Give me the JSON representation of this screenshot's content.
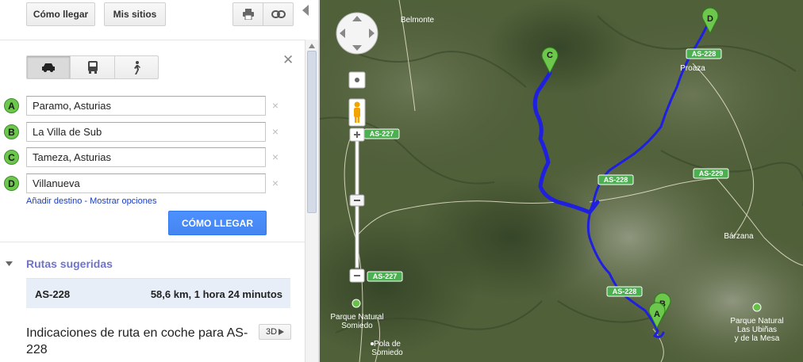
{
  "topbar": {
    "directions_label": "Cómo llegar",
    "my_places_label": "Mis sitios"
  },
  "waypoints": [
    {
      "letter": "A",
      "value": "Paramo, Asturias"
    },
    {
      "letter": "B",
      "value": "La Villa de Sub"
    },
    {
      "letter": "C",
      "value": "Tameza, Asturias"
    },
    {
      "letter": "D",
      "value": "Villanueva"
    }
  ],
  "links": {
    "add_destination": "Añadir destino",
    "separator": " - ",
    "show_options": "Mostrar opciones"
  },
  "submit_label": "CÓMO LLEGAR",
  "routes": {
    "header": "Rutas sugeridas",
    "items": [
      {
        "name": "AS-228",
        "summary": "58,6 km, 1 hora 24 minutos"
      }
    ]
  },
  "driving": {
    "title": "Indicaciones de ruta en coche para AS-228",
    "button_3d": "3D"
  },
  "map": {
    "place_labels": {
      "belmonte": "Belmonte",
      "proaza": "Proaza",
      "barzana": "Bárzana",
      "parque_somiedo_1": "Parque Natural",
      "parque_somiedo_2": "Somiedo",
      "parque_ubinas_1": "Parque Natural",
      "parque_ubinas_2": "Las Ubiñas",
      "parque_ubinas_3": "y de la Mesa",
      "pola_1": "Pola de",
      "pola_2": "Somiedo"
    },
    "road_shields": {
      "as228_top": "AS-228",
      "as227_a": "AS-227",
      "as228_mid": "AS-228",
      "as229": "AS-229",
      "as227_b": "AS-227",
      "as228_bottom": "AS-228"
    },
    "markers": {
      "a": "A",
      "b": "B",
      "c": "C",
      "d": "D"
    },
    "route_color": "#1f1fe0",
    "marker_color": "#6dc74d"
  }
}
